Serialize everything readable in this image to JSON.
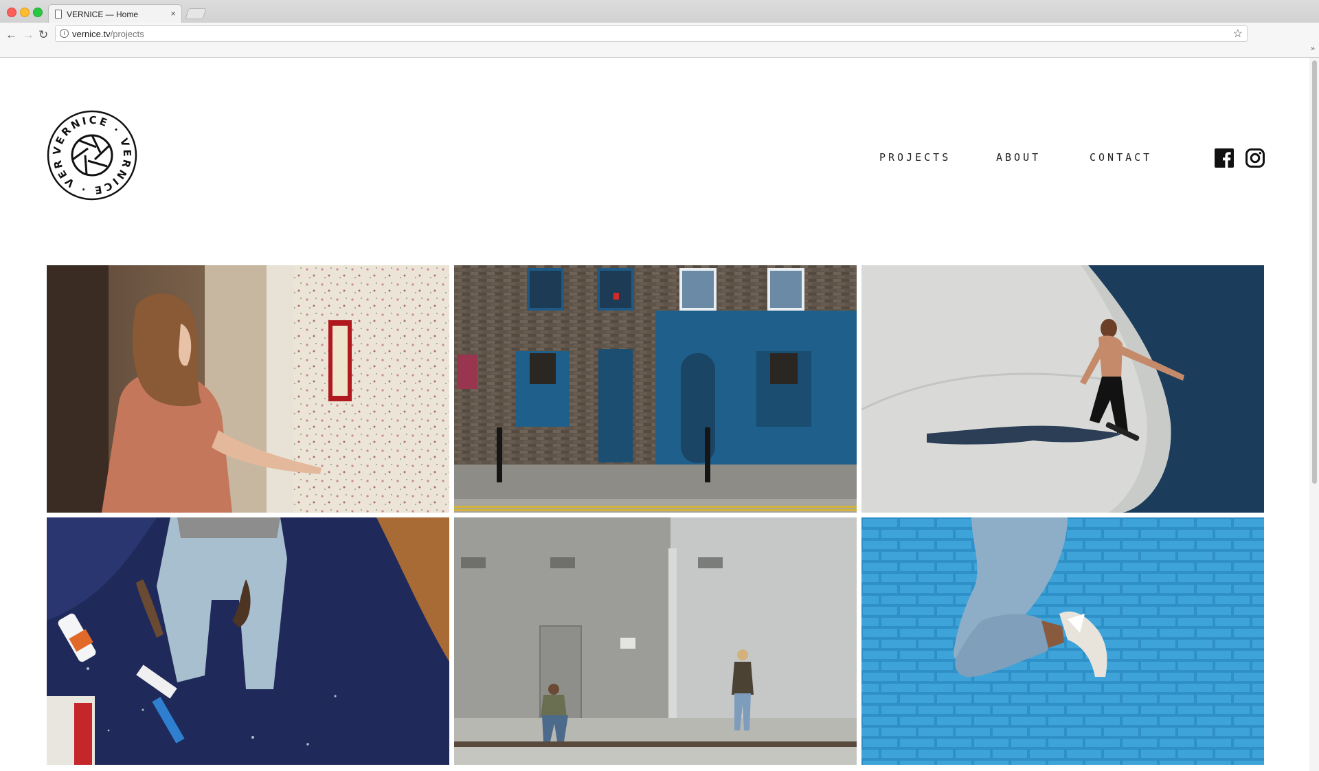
{
  "browser": {
    "tab_title": "VERNICE — Home",
    "url_domain": "vernice.tv",
    "url_path": "/projects"
  },
  "site": {
    "logo_text": "VERNICE · VERNICE · VERNICE ·",
    "nav": {
      "projects": "PROJECTS",
      "about": "ABOUT",
      "contact": "CONTACT"
    },
    "social_icons": [
      "facebook-icon",
      "instagram-icon"
    ]
  },
  "gallery": {
    "photos": [
      "woman touching floral wallpaper",
      "brick townhouses with blue facade",
      "skateboarder in concrete bowl",
      "painter kneeling on blue cloth",
      "two people by grey wall",
      "jumping legs against blue brick wall"
    ]
  },
  "colors": {
    "accent_blue": "#1f5f8b",
    "sky_blue": "#3ea3d8",
    "text": "#222222"
  }
}
